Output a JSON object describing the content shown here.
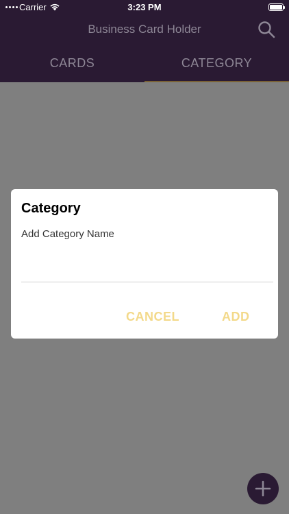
{
  "status_bar": {
    "carrier": "Carrier",
    "time": "3:23 PM"
  },
  "app": {
    "title": "Business Card Holder"
  },
  "tabs": [
    {
      "label": "CARDS"
    },
    {
      "label": "CATEGORY"
    }
  ],
  "dialog": {
    "title": "Category",
    "input_placeholder": "Add Category Name",
    "input_value": "",
    "cancel_label": "CANCEL",
    "add_label": "ADD"
  },
  "icons": {
    "search": "search-icon",
    "fab": "plus-icon",
    "wifi": "wifi-icon",
    "battery": "battery-icon"
  },
  "colors": {
    "header_bg": "#2a1a33",
    "overlay_bg": "#7f7f7f",
    "accent": "#f3d98a",
    "muted_text": "#8e8796"
  }
}
